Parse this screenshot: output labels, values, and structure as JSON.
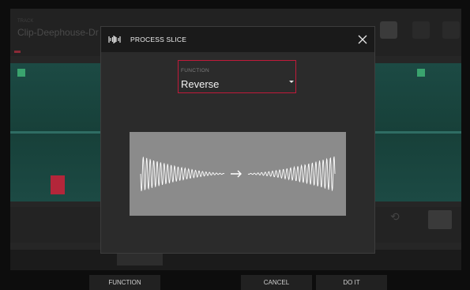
{
  "background": {
    "clip_name": "Clip-Deephouse-Dr",
    "small_tag": "TRACK",
    "colors": {
      "wave": "#1c4a44",
      "accent_red": "#c01a3a",
      "green_marker": "#3aa36e"
    }
  },
  "dialog": {
    "title": "PROCESS SLICE",
    "icon": "waveform-process-icon",
    "close_icon": "close-icon",
    "function_field": {
      "label": "FUNCTION",
      "value": "Reverse",
      "caret_icon": "caret-down-icon"
    },
    "preview": {
      "description_icon": "reverse-waveform-illustration",
      "arrow_icon": "arrow-right-icon"
    }
  },
  "footer": {
    "function_label": "FUNCTION",
    "cancel_label": "CANCEL",
    "doit_label": "DO IT"
  }
}
